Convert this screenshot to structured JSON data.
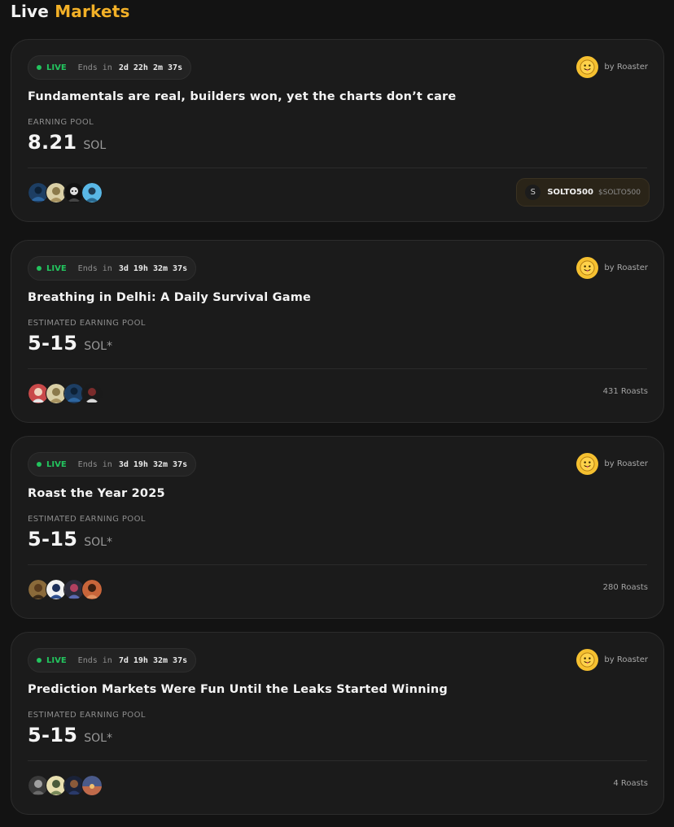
{
  "header": {
    "title_part1": "Live",
    "title_part2": "Markets"
  },
  "markets": [
    {
      "status": "LIVE",
      "ends_label": "Ends in",
      "countdown": "2d 22h 2m 37s",
      "creator": "by Roaster",
      "title": "Fundamentals are real, builders won, yet the charts don’t care",
      "pool_label": "EARNING POOL",
      "pool_value": "8.21",
      "pool_unit": "SOL",
      "token": {
        "icon_letter": "S",
        "name": "SOLTO500",
        "ticker": "$SOLTO500"
      }
    },
    {
      "status": "LIVE",
      "ends_label": "Ends in",
      "countdown": "3d 19h 32m 37s",
      "creator": "by Roaster",
      "title": "Breathing in Delhi: A Daily Survival Game",
      "pool_label": "ESTIMATED EARNING POOL",
      "pool_value": "5-15",
      "pool_unit": "SOL*",
      "roasts": "431 Roasts"
    },
    {
      "status": "LIVE",
      "ends_label": "Ends in",
      "countdown": "3d 19h 32m 37s",
      "creator": "by Roaster",
      "title": "Roast the Year 2025",
      "pool_label": "ESTIMATED EARNING POOL",
      "pool_value": "5-15",
      "pool_unit": "SOL*",
      "roasts": "280 Roasts"
    },
    {
      "status": "LIVE",
      "ends_label": "Ends in",
      "countdown": "7d 19h 32m 37s",
      "creator": "by Roaster",
      "title": "Prediction Markets Were Fun Until the Leaks Started Winning",
      "pool_label": "ESTIMATED EARNING POOL",
      "pool_value": "5-15",
      "pool_unit": "SOL*",
      "roasts": "4 Roasts"
    }
  ],
  "colors": {
    "accent": "#f2b027",
    "live": "#23c45e",
    "card_bg": "#1b1b1b",
    "page_bg": "#131313"
  },
  "icons": {
    "creator_avatar": "tongue-out-face-icon",
    "participant_avatar": "user-avatar-icon",
    "token": "token-icon"
  }
}
